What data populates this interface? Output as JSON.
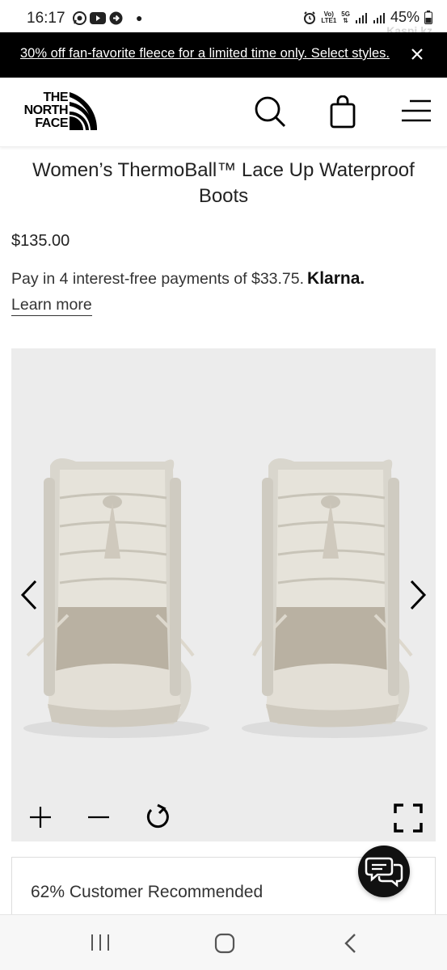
{
  "status_bar": {
    "time": "16:17",
    "battery": "45%",
    "network_top": "Vo)",
    "network_bottom": "LTE1",
    "five_g": "5G",
    "app_icons": [
      "whatsapp-icon",
      "youtube-icon",
      "arrow-circle-icon"
    ],
    "watermark": "Kaspi.kz"
  },
  "promo": {
    "text": "30% off fan-favorite fleece for a limited time only. Select styles.",
    "background": "#000000"
  },
  "header": {
    "logo_text_line1": "THE",
    "logo_text_line2": "NORTH",
    "logo_text_line3": "FACE",
    "icons": [
      "search-icon",
      "shopping-bag-icon",
      "hamburger-menu-icon"
    ]
  },
  "product": {
    "title": "Women’s ThermoBall™ Lace Up Waterproof Boots",
    "price": "$135.00",
    "klarna_text": "Pay in 4 interest-free payments of $33.75.",
    "klarna_brand": "Klarna.",
    "learn_more": "Learn more"
  },
  "gallery": {
    "background": "#ececec",
    "controls": [
      "chevron-left-icon",
      "chevron-right-icon",
      "zoom-in-icon",
      "zoom-out-icon",
      "rotate-icon",
      "fullscreen-icon"
    ]
  },
  "recommendation": {
    "text": "62% Customer Recommended"
  },
  "chat": {
    "icon": "chat-bubbles-icon"
  },
  "nav_bar": {
    "icons": [
      "recents-icon",
      "home-icon",
      "back-icon"
    ]
  }
}
